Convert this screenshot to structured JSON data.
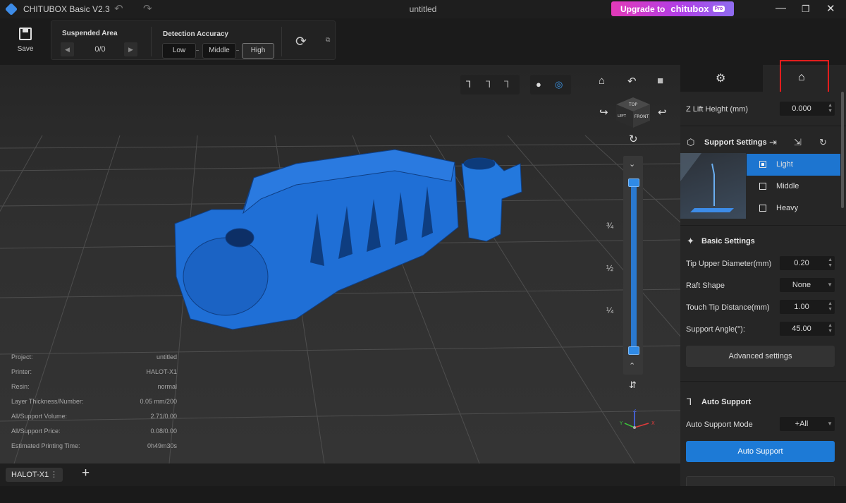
{
  "app": {
    "title": "CHITUBOX Basic V2.3",
    "window_title": "untitled",
    "upgrade_prefix": "Upgrade to",
    "upgrade_brand": "chitubox",
    "upgrade_badge": "Pro"
  },
  "toolbar": {
    "save_label": "Save",
    "suspended_area_title": "Suspended Area",
    "suspended_area_count": "0/0",
    "detection_accuracy_title": "Detection Accuracy",
    "accuracy_options": [
      "Low",
      "Middle",
      "High"
    ],
    "accuracy_selected": "High"
  },
  "model_info": {
    "rows": [
      {
        "key": "Project:",
        "value": "untitled"
      },
      {
        "key": "Printer:",
        "value": "HALOT-X1"
      },
      {
        "key": "Resin:",
        "value": "normal"
      },
      {
        "key": "Layer Thickness/Number:",
        "value": "0.05 mm/200"
      },
      {
        "key": "All/Support Volume:",
        "value": "2.71/0.00"
      },
      {
        "key": "All/Support Price:",
        "value": "0.08/0.00"
      },
      {
        "key": "Estimated Printing Time:",
        "value": "0h49m30s"
      }
    ]
  },
  "slider": {
    "fractions": [
      "¾",
      "½",
      "¼"
    ],
    "nav_cube": {
      "top": "TOP",
      "left": "LEFT",
      "front": "FRONT"
    }
  },
  "bottom": {
    "printer_tab": "HALOT-X1"
  },
  "panel": {
    "z_lift_label": "Z Lift Height (mm)",
    "z_lift_value": "0.000",
    "support_settings_title": "Support Settings",
    "support_levels": [
      "Light",
      "Middle",
      "Heavy"
    ],
    "support_level_selected": "Light",
    "basic_settings_title": "Basic Settings",
    "tip_upper_label": "Tip Upper Diameter(mm)",
    "tip_upper_value": "0.20",
    "raft_shape_label": "Raft Shape",
    "raft_shape_value": "None",
    "touch_tip_label": "Touch Tip Distance(mm)",
    "touch_tip_value": "1.00",
    "support_angle_label": "Support Angle(°):",
    "support_angle_value": "45.00",
    "advanced_label": "Advanced settings",
    "auto_support_title": "Auto Support",
    "auto_mode_label": "Auto Support Mode",
    "auto_mode_value": "+All",
    "auto_support_button": "Auto Support"
  },
  "colors": {
    "accent": "#1d7ad6",
    "model": "#1f6fd6",
    "highlight": "#e21d1d",
    "upgrade_gradient_start": "#e23ab8",
    "upgrade_gradient_end": "#8f6cf0"
  },
  "icons": [
    "app-logo-icon",
    "undo-icon",
    "redo-icon",
    "minimize-icon",
    "maximize-icon",
    "close-icon",
    "save-icon",
    "refresh-icon",
    "home-icon",
    "rotate-icon",
    "cube-icon",
    "support-tab-icon",
    "settings-tab-icon"
  ]
}
